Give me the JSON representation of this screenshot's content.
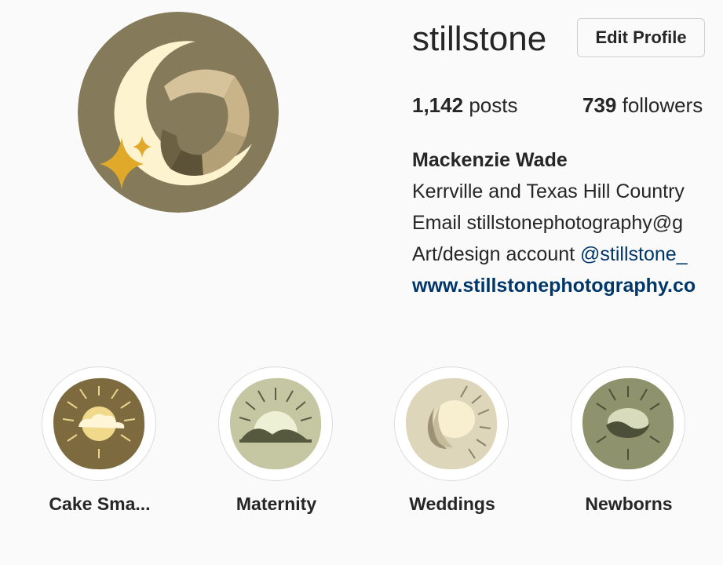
{
  "profile": {
    "username": "stillstone",
    "edit_button": "Edit Profile",
    "stats": [
      {
        "count": "1,142",
        "label": "posts"
      },
      {
        "count": "739",
        "label": "followers"
      }
    ],
    "bio": {
      "name": "Mackenzie Wade",
      "line1": "Kerrville and Texas Hill Country",
      "line2": "Email stillstonephotography@g",
      "line3_prefix": "Art/design account ",
      "line3_mention": "@stillstone_",
      "website": "www.stillstonephotography.co"
    },
    "avatar_icon": "moon-shutter-logo"
  },
  "highlights": [
    {
      "label": "Cake Sma...",
      "icon": "sun-cloud-icon"
    },
    {
      "label": "Maternity",
      "icon": "sunrise-hills-icon"
    },
    {
      "label": "Weddings",
      "icon": "moon-rays-icon"
    },
    {
      "label": "Newborns",
      "icon": "sun-wave-icon"
    }
  ],
  "colors": {
    "avatar_bg": "#857a5a",
    "moon": "#fdf3cf",
    "sparkle": "#e0a92a",
    "link": "#00376b"
  }
}
